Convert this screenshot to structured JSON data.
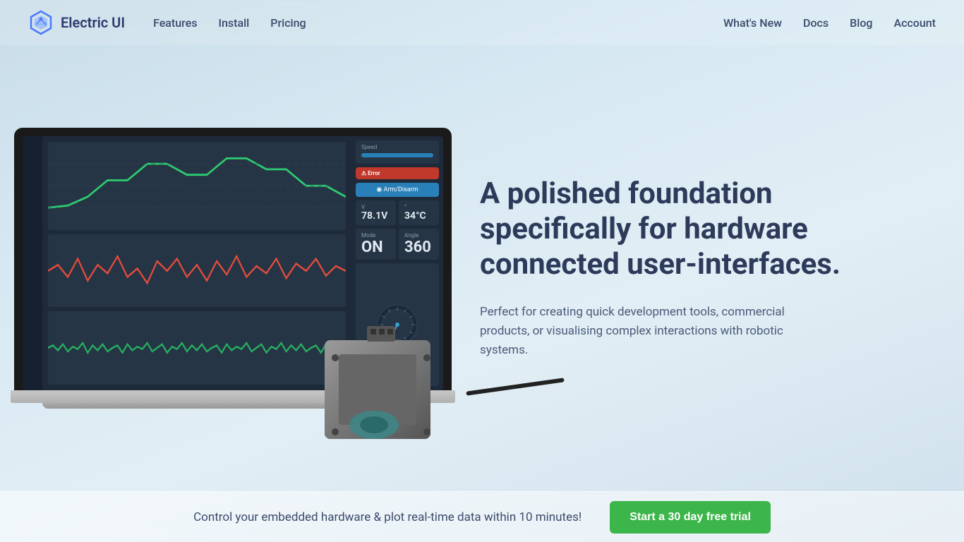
{
  "nav": {
    "logo_text": "Electric UI",
    "links": [
      {
        "label": "Features",
        "href": "#"
      },
      {
        "label": "Install",
        "href": "#"
      },
      {
        "label": "Pricing",
        "href": "#"
      }
    ],
    "right_links": [
      {
        "label": "What's New",
        "href": "#"
      },
      {
        "label": "Docs",
        "href": "#"
      },
      {
        "label": "Blog",
        "href": "#"
      },
      {
        "label": "Account",
        "href": "#"
      }
    ]
  },
  "hero": {
    "title": "A polished foundation specifically for hardware connected user-interfaces.",
    "subtitle": "Perfect for creating quick development tools, commercial products, or visualising complex interactions with robotic systems."
  },
  "bottom_bar": {
    "text": "Control your embedded hardware & plot real-time data within 10 minutes!",
    "cta_label": "Start a 30 day free trial"
  },
  "dashboard": {
    "stats": [
      {
        "label": "Speed",
        "value": "78.1V"
      },
      {
        "label": "",
        "value": "34°C"
      },
      {
        "label": "Mode",
        "value": "ON"
      },
      {
        "label": "Angle",
        "value": "360"
      }
    ]
  }
}
